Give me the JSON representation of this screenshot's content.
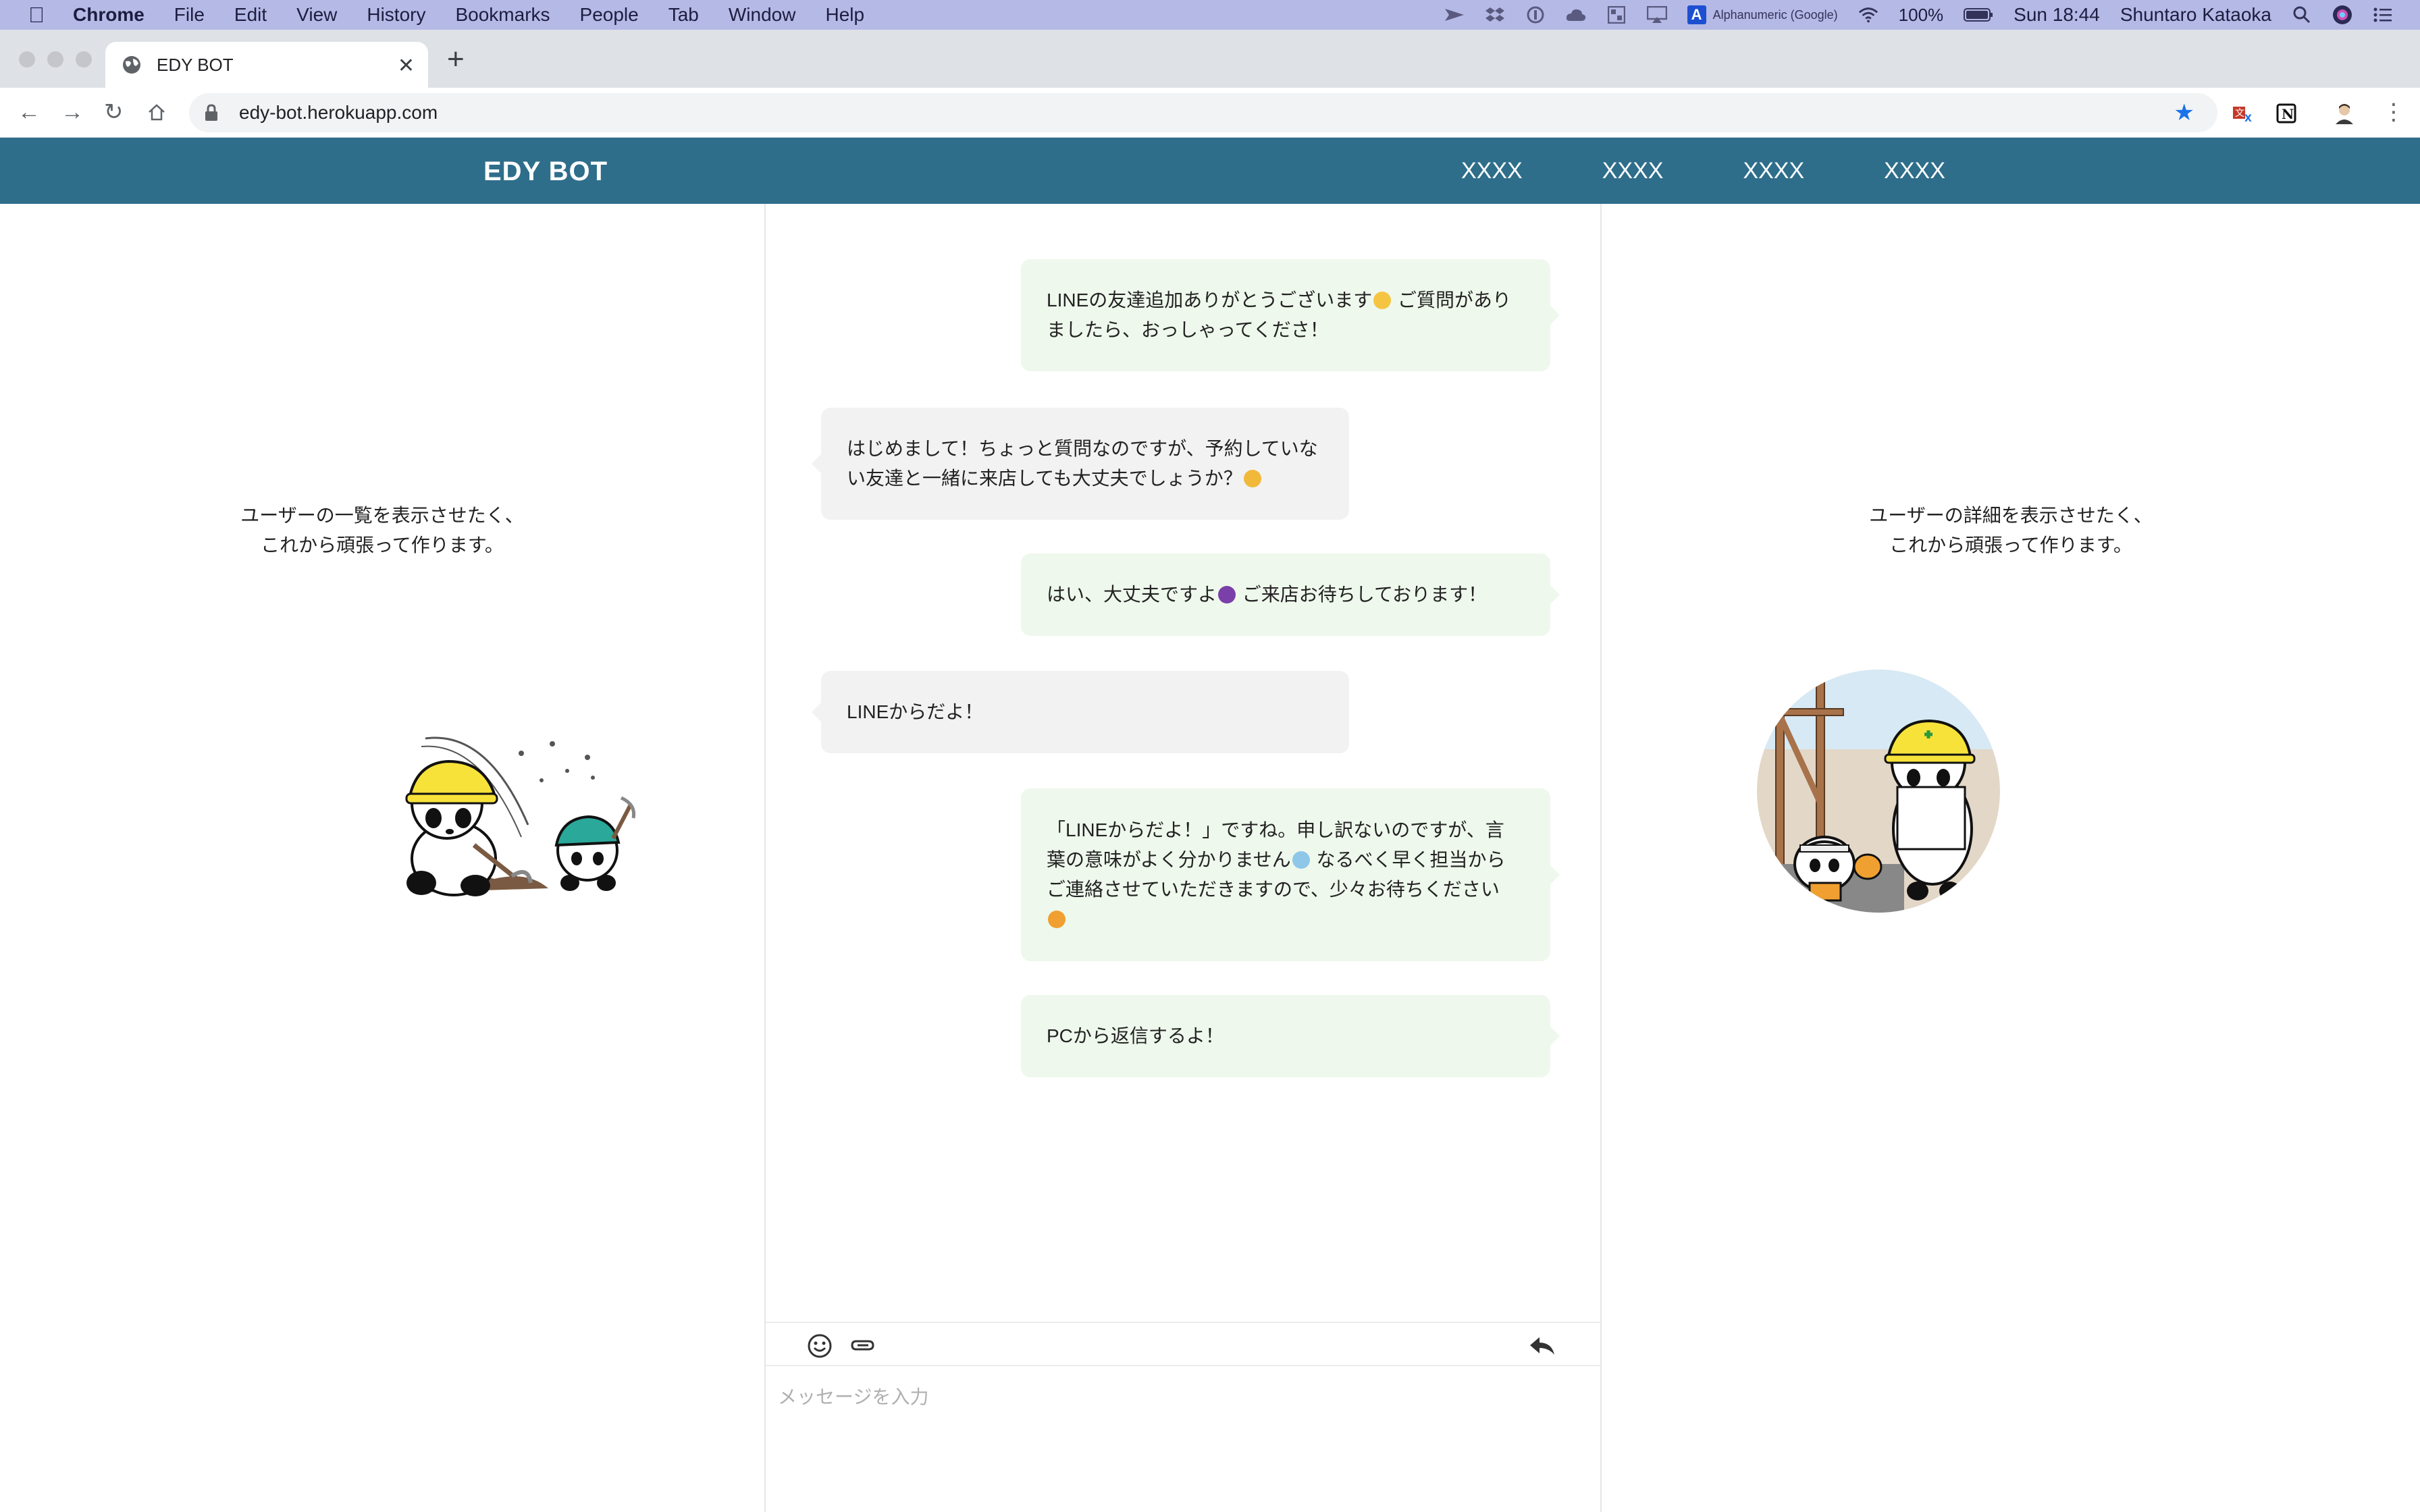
{
  "menubar": {
    "items": [
      "Chrome",
      "File",
      "Edit",
      "View",
      "History",
      "Bookmarks",
      "People",
      "Tab",
      "Window",
      "Help"
    ],
    "input_source": "Alphanumeric (Google)",
    "battery": "100%",
    "clock": "Sun 18:44",
    "user": "Shuntaro Kataoka"
  },
  "browser": {
    "tab_title": "EDY BOT",
    "url": "edy-bot.herokuapp.com"
  },
  "app": {
    "brand": "EDY BOT",
    "nav": [
      "XXXX",
      "XXXX",
      "XXXX",
      "XXXX"
    ]
  },
  "left_panel": {
    "line1": "ユーザーの一覧を表示させたく、",
    "line2": "これから頑張って作ります。"
  },
  "right_panel": {
    "line1": "ユーザーの詳細を表示させたく、",
    "line2": "これから頑張って作ります。"
  },
  "messages": [
    {
      "sender": "bot",
      "l1a": "LINEの友達追加ありがとうございます",
      "l1b": " ご質問があり",
      "l2": "ましたら、おっしゃってくださ！"
    },
    {
      "sender": "user",
      "l1": "はじめまして！ちょっと質問なのですが、予約していな",
      "l2": "い友達と一緒に来店しても大丈夫でしょうか？"
    },
    {
      "sender": "bot",
      "l1a": "はい、大丈夫ですよ",
      "l1b": " ご来店お待ちしております！"
    },
    {
      "sender": "user",
      "l1": "LINEからだよ！"
    },
    {
      "sender": "bot",
      "l1": "「LINEからだよ！」ですね。申し訳ないのですが、言",
      "l2a": "葉の意味がよく分かりません",
      "l2b": " なるべく早く担当から",
      "l3": "ご連絡させていただきますので、少々お待ちください"
    },
    {
      "sender": "bot",
      "l1": "PCから返信するよ！"
    }
  ],
  "emoji_colors": {
    "grin": "#f5c542",
    "think": "#f0b93a",
    "bow": "#7a3fa8",
    "sweat": "#8ec7e8",
    "bow2": "#f0a030"
  },
  "composer": {
    "placeholder": "メッセージを入力",
    "value": ""
  }
}
